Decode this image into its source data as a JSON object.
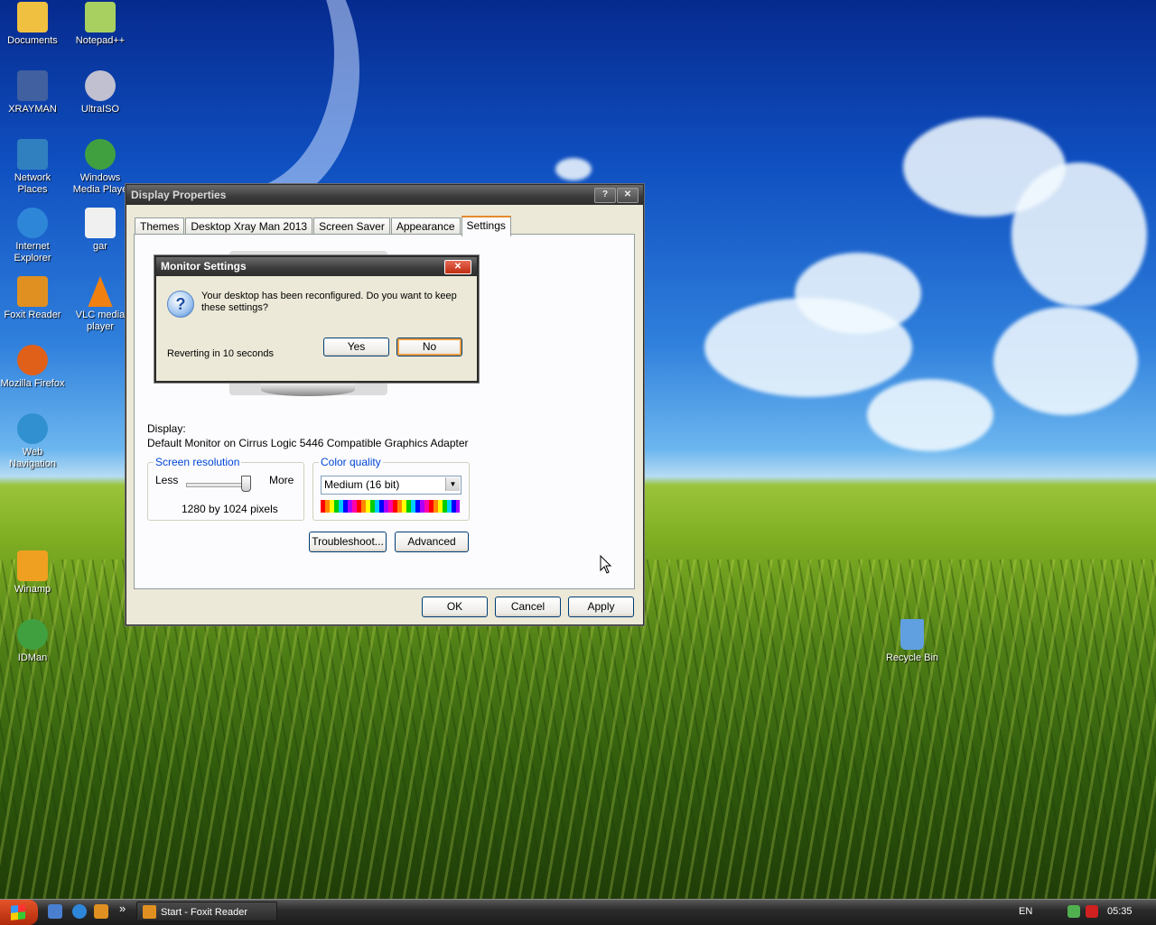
{
  "desktop_icons": [
    {
      "label": "Documents",
      "icon": "folder-icon",
      "color": "#f0c040"
    },
    {
      "label": "Notepad++",
      "icon": "notepad-icon",
      "color": "#a8d060"
    },
    {
      "label": "XRAYMAN",
      "icon": "computer-icon",
      "color": "#4060a0"
    },
    {
      "label": "UltraISO",
      "icon": "disc-icon",
      "color": "#c0c0d0"
    },
    {
      "label": "Network Places",
      "icon": "network-icon",
      "color": "#3080c0"
    },
    {
      "label": "Windows Media Playe",
      "icon": "media-player-icon",
      "color": "#40a040"
    },
    {
      "label": "Internet Explorer",
      "icon": "internet-explorer-icon",
      "color": "#2e86d8"
    },
    {
      "label": "gar",
      "icon": "document-icon",
      "color": "#f0f0f0"
    },
    {
      "label": "Foxit Reader",
      "icon": "foxit-icon",
      "color": "#e09020"
    },
    {
      "label": "VLC media player",
      "icon": "vlc-cone-icon",
      "color": "#f08010"
    },
    {
      "label": "Mozilla Firefox",
      "icon": "firefox-icon",
      "color": "#e0601a"
    },
    {
      "label": "Web Navigation",
      "icon": "globe-icon",
      "color": "#3090d0"
    },
    {
      "label": "Winamp",
      "icon": "winamp-icon",
      "color": "#f0a020"
    },
    {
      "label": "IDMan",
      "icon": "download-manager-icon",
      "color": "#40a040"
    },
    {
      "label": "Recycle Bin",
      "icon": "recycle-bin-icon",
      "color": "#60a0e0"
    }
  ],
  "display_properties": {
    "title": "Display Properties",
    "help_button": "?",
    "close_button": "✕",
    "tabs": [
      "Themes",
      "Desktop Xray Man 2013",
      "Screen Saver",
      "Appearance",
      "Settings"
    ],
    "active_tab": "Settings",
    "display_label": "Display:",
    "display_value": "Default Monitor on Cirrus Logic 5446 Compatible Graphics Adapter",
    "screen_resolution": {
      "title": "Screen resolution",
      "less": "Less",
      "more": "More",
      "value": "1280 by 1024 pixels"
    },
    "color_quality": {
      "title": "Color quality",
      "selected": "Medium (16 bit)"
    },
    "troubleshoot_button": "Troubleshoot...",
    "advanced_button": "Advanced",
    "ok_button": "OK",
    "cancel_button": "Cancel",
    "apply_button": "Apply"
  },
  "monitor_settings": {
    "title": "Monitor Settings",
    "close_button": "✕",
    "message": "Your desktop has been reconfigured.  Do you want to keep these settings?",
    "countdown": "Reverting in 10 seconds",
    "yes_button": "Yes",
    "no_button": "No"
  },
  "taskbar": {
    "task_label": "Start - Foxit Reader",
    "chevron": "»",
    "language": "EN",
    "clock": "05:35"
  }
}
